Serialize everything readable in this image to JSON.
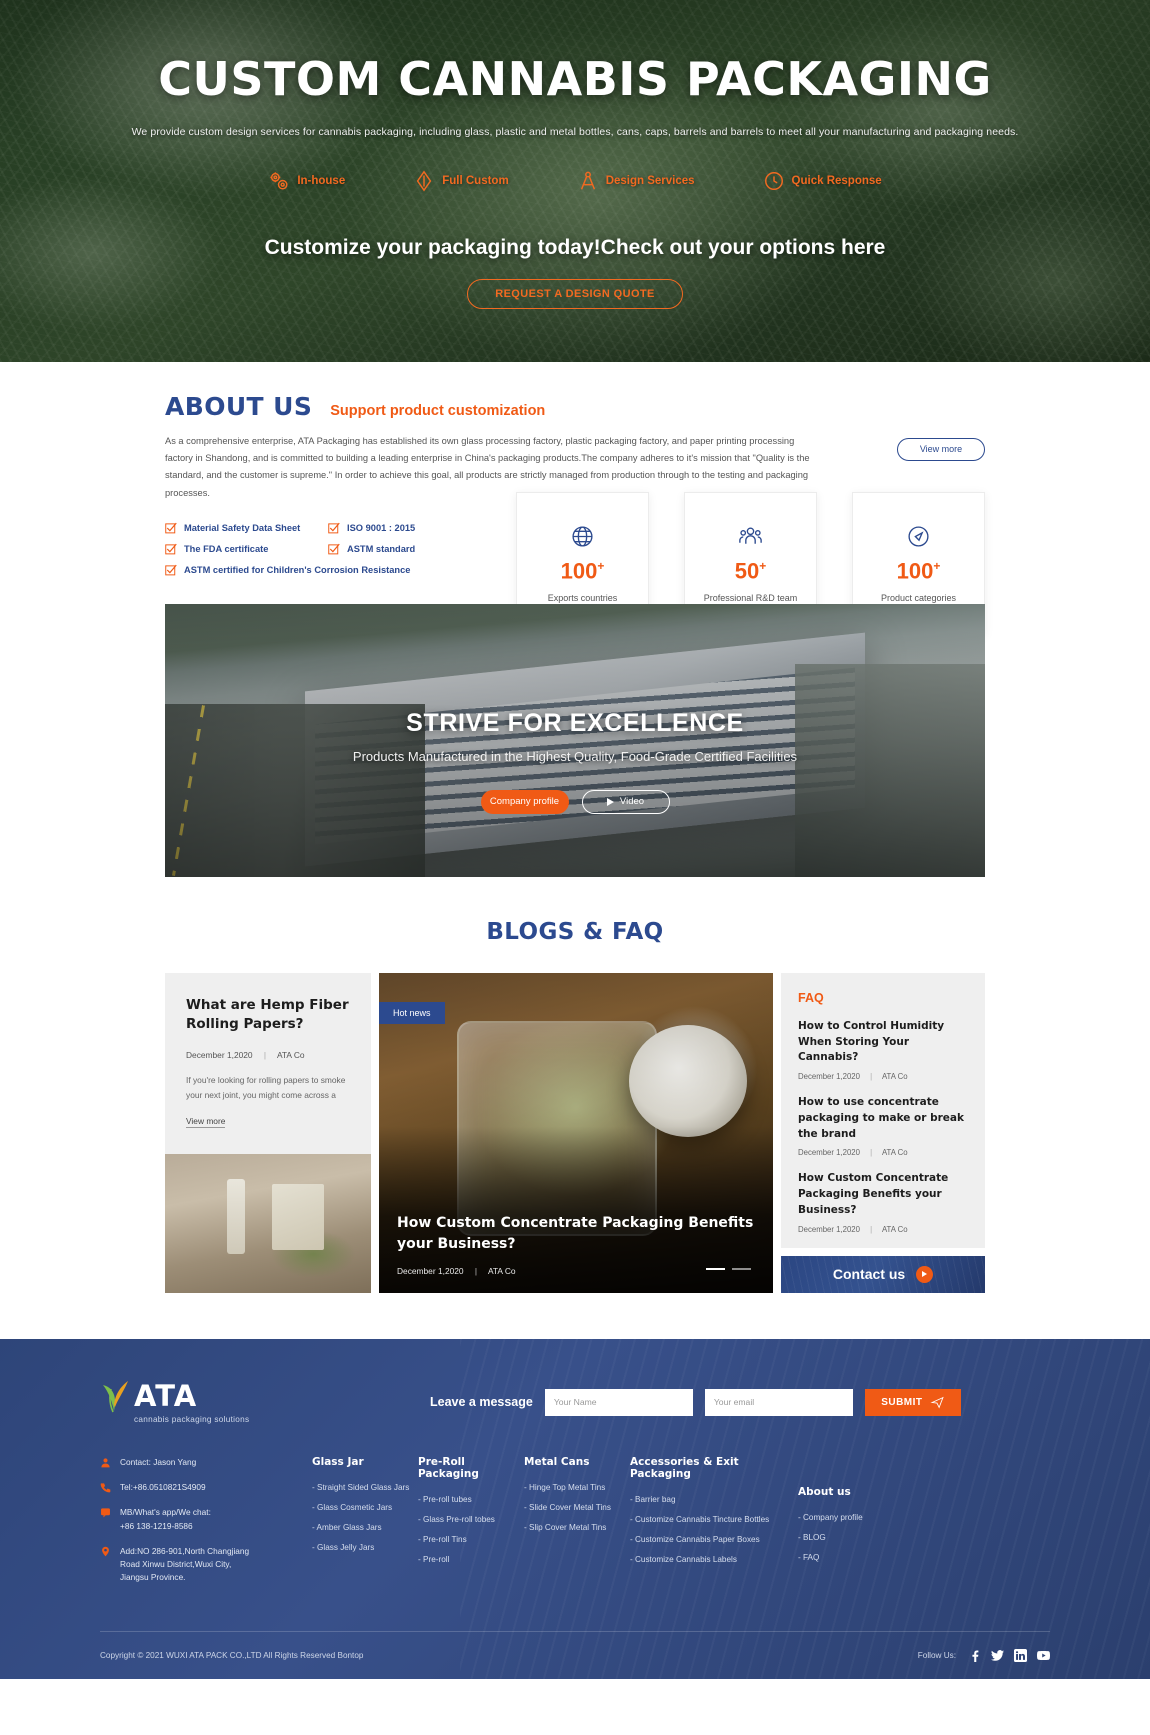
{
  "hero": {
    "title": "CUSTOM CANNABIS PACKAGING",
    "subtitle": "We provide custom design services for cannabis packaging, including glass, plastic and metal bottles, cans, caps, barrels and barrels to meet all your manufacturing and packaging needs.",
    "features": [
      {
        "label": "In-house",
        "icon": "gears-icon"
      },
      {
        "label": "Full Custom",
        "icon": "pen-nib-icon"
      },
      {
        "label": "Design Services",
        "icon": "compass-icon"
      },
      {
        "label": "Quick Response",
        "icon": "clock-icon"
      }
    ],
    "cta_title": "Customize your packaging today!Check out your options here",
    "cta_button": "REQUEST A DESIGN QUOTE",
    "accent_color": "#f26a21"
  },
  "about": {
    "title": "ABOUT US",
    "tagline": "Support product customization",
    "body": "As a comprehensive enterprise, ATA Packaging has established its own glass processing factory, plastic packaging factory, and paper printing processing factory in Shandong, and is committed to building a leading enterprise in China's packaging products.The company adheres to it's mission that \"Quality is the standard, and the customer is supreme.\"  In order to achieve this goal, all products are strictly managed from production through to the testing and packaging processes.",
    "view_more": "View more",
    "certs": [
      [
        "Material Safety Data Sheet",
        "ISO 9001 : 2015"
      ],
      [
        "The FDA certificate",
        "ASTM standard"
      ],
      [
        "ASTM certified for Children's Corrosion Resistance",
        ""
      ]
    ],
    "stats": [
      {
        "icon": "globe-icon",
        "number": "100",
        "plus": "+",
        "label": "Exports countries"
      },
      {
        "icon": "people-icon",
        "number": "50",
        "plus": "+",
        "label": "Professional R&D team"
      },
      {
        "icon": "tag-icon",
        "number": "100",
        "plus": "+",
        "label": "Product categories"
      }
    ],
    "title_color": "#2c4a8f",
    "tagline_color": "#f05a15"
  },
  "building": {
    "title": "STRIVE FOR EXCELLENCE",
    "subtitle": "Products Manufactured in the Highest Quality, Food-Grade Certified Facilities",
    "primary_button": "Company profile",
    "video_button": "Video"
  },
  "blogs": {
    "section_title": "BLOGS & FAQ",
    "left_card": {
      "heading": "What are Hemp Fiber Rolling Papers?",
      "date": "December 1,2020",
      "author": "ATA Co",
      "excerpt": "If you're looking for rolling papers to smoke your next joint, you might come across a",
      "view_more": "View more"
    },
    "center_card": {
      "badge": "Hot news",
      "heading": "How Custom Concentrate Packaging Benefits your Business?",
      "date": "December 1,2020",
      "author": "ATA Co"
    },
    "faq": {
      "title": "FAQ",
      "items": [
        {
          "question": "How to Control Humidity When Storing Your Cannabis?",
          "date": "December 1,2020",
          "author": "ATA Co"
        },
        {
          "question": "How to use concentrate packaging to make or break the brand",
          "date": "December 1,2020",
          "author": "ATA Co"
        },
        {
          "question": "How Custom Concentrate Packaging Benefits your Business?",
          "date": "December 1,2020",
          "author": "ATA Co"
        }
      ]
    },
    "contact_box": "Contact us"
  },
  "footer": {
    "logo_text": "ATA",
    "logo_sub": "cannabis  packaging solutions",
    "message_label": "Leave a message",
    "name_placeholder": "Your Name",
    "email_placeholder": "Your email",
    "submit_label": "SUBMIT",
    "contact": [
      {
        "icon": "person-icon",
        "text": "Contact: Jason Yang"
      },
      {
        "icon": "phone-icon",
        "text": "Tel:+86.0510821S4909"
      },
      {
        "icon": "chat-icon",
        "text": "MB/What's app/We chat:\n+86 138-1219-8586"
      },
      {
        "icon": "location-icon",
        "text": "Add:NO 286-901,North Changjiang\nRoad Xinwu District,Wuxi City,\nJiangsu Province."
      }
    ],
    "columns": [
      {
        "heading": "Glass Jar",
        "items": [
          "- Straight Sided Glass Jars",
          "- Glass Cosmetic Jars",
          "- Amber Glass Jars",
          "- Glass Jelly Jars"
        ]
      },
      {
        "heading": "Pre-Roll Packaging",
        "items": [
          "- Pre-roll tubes",
          "- Glass Pre-roll tobes",
          "- Pre-roll Tins",
          "- Pre-roll"
        ]
      },
      {
        "heading": "Metal Cans",
        "items": [
          "- Hinge Top Metal Tins",
          "- Slide Cover Metal Tins",
          "- Slip Cover Metal Tins"
        ]
      },
      {
        "heading": "Accessories & Exit Packaging",
        "items": [
          "- Barrier bag",
          "- Customize Cannabis Tincture Bottles",
          "- Customize Cannabis Paper Boxes",
          "- Customize Cannabis Labels"
        ]
      },
      {
        "heading": "About us",
        "items": [
          "- Company profile",
          "- BLOG",
          "- FAQ"
        ]
      }
    ],
    "copyright": "Copyright © 2021 WUXI ATA PACK CO.,LTD All Rights Reserved   Bontop",
    "follow_label": "Follow Us:",
    "socials": [
      "facebook-icon",
      "twitter-icon",
      "linkedin-icon",
      "youtube-icon"
    ]
  }
}
